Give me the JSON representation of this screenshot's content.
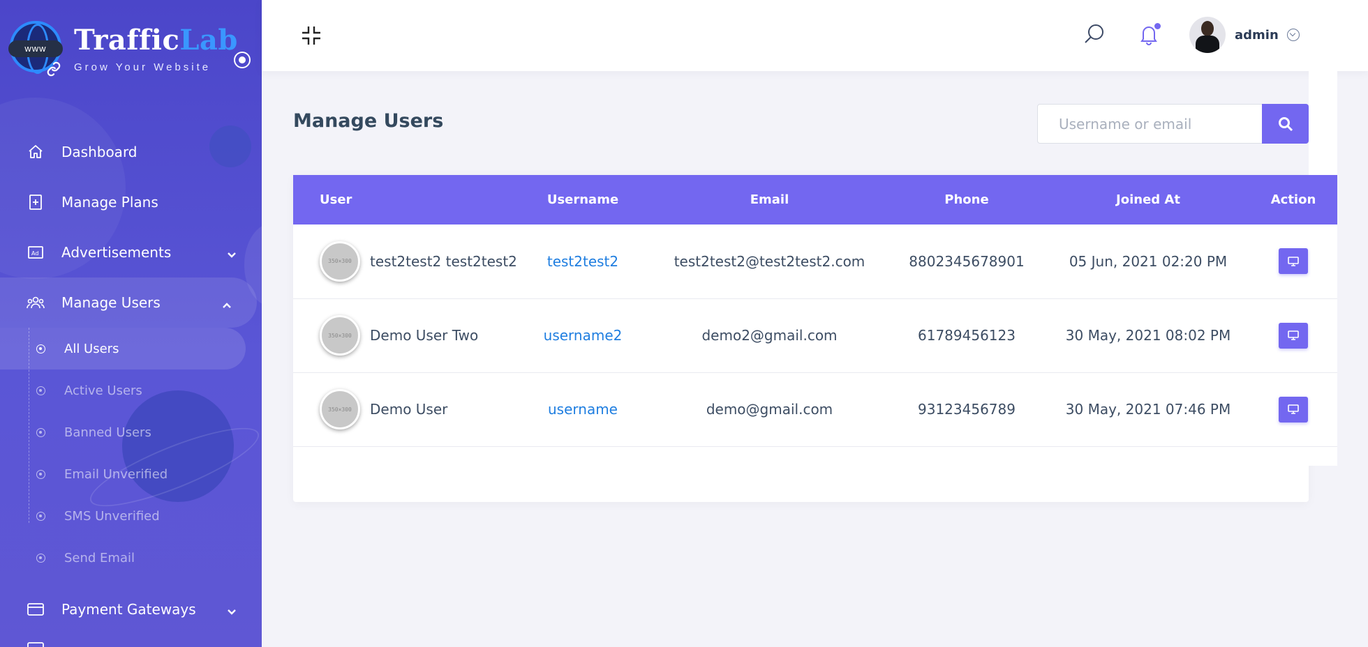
{
  "brand": {
    "globe_text": "www",
    "name_part1": "Traffic",
    "name_part2": "Lab",
    "tagline": "Grow Your Website"
  },
  "sidebar": {
    "items": [
      {
        "label": "Dashboard",
        "icon": "home-icon"
      },
      {
        "label": "Manage Plans",
        "icon": "plans-icon"
      },
      {
        "label": "Advertisements",
        "icon": "ad-icon",
        "expandable": true
      },
      {
        "label": "Manage Users",
        "icon": "users-icon",
        "expandable": true,
        "open": true
      },
      {
        "label": "Payment Gateways",
        "icon": "card-icon",
        "expandable": true
      }
    ],
    "users_submenu": [
      {
        "label": "All Users",
        "active": true
      },
      {
        "label": "Active Users"
      },
      {
        "label": "Banned Users"
      },
      {
        "label": "Email Unverified"
      },
      {
        "label": "SMS Unverified"
      },
      {
        "label": "Send Email"
      }
    ]
  },
  "topbar": {
    "admin_name": "admin"
  },
  "main": {
    "title": "Manage Users",
    "search": {
      "placeholder": "Username or email",
      "value": ""
    },
    "table": {
      "headers": [
        "User",
        "Username",
        "Email",
        "Phone",
        "Joined At",
        "Action"
      ],
      "thumb_text": "350×300",
      "rows": [
        {
          "name": "test2test2 test2test2",
          "username": "test2test2",
          "email": "test2test2@test2test2.com",
          "phone": "8802345678901",
          "joined": "05 Jun, 2021 02:20 PM"
        },
        {
          "name": "Demo User Two",
          "username": "username2",
          "email": "demo2@gmail.com",
          "phone": "61789456123",
          "joined": "30 May, 2021 08:02 PM"
        },
        {
          "name": "Demo User",
          "username": "username",
          "email": "demo@gmail.com",
          "phone": "93123456789",
          "joined": "30 May, 2021 07:46 PM"
        }
      ]
    }
  },
  "colors": {
    "sidebar_top": "#4b46c9",
    "accent": "#7367f0",
    "link": "#1f7ee0",
    "brand_blue": "#3a97ff"
  }
}
